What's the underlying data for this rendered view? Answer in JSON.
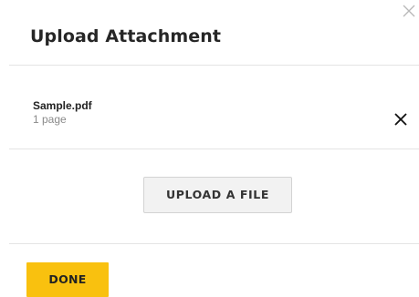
{
  "dialog": {
    "title": "Upload Attachment",
    "close_icon": "close-icon"
  },
  "attachment": {
    "file_name": "Sample.pdf",
    "page_count": "1 page",
    "remove_icon": "close-icon"
  },
  "actions": {
    "upload_label": "UPLOAD A FILE",
    "done_label": "DONE"
  },
  "colors": {
    "done_button": "#f9c10f",
    "upload_button": "#f2f2f2",
    "divider": "#e4e4e4"
  }
}
